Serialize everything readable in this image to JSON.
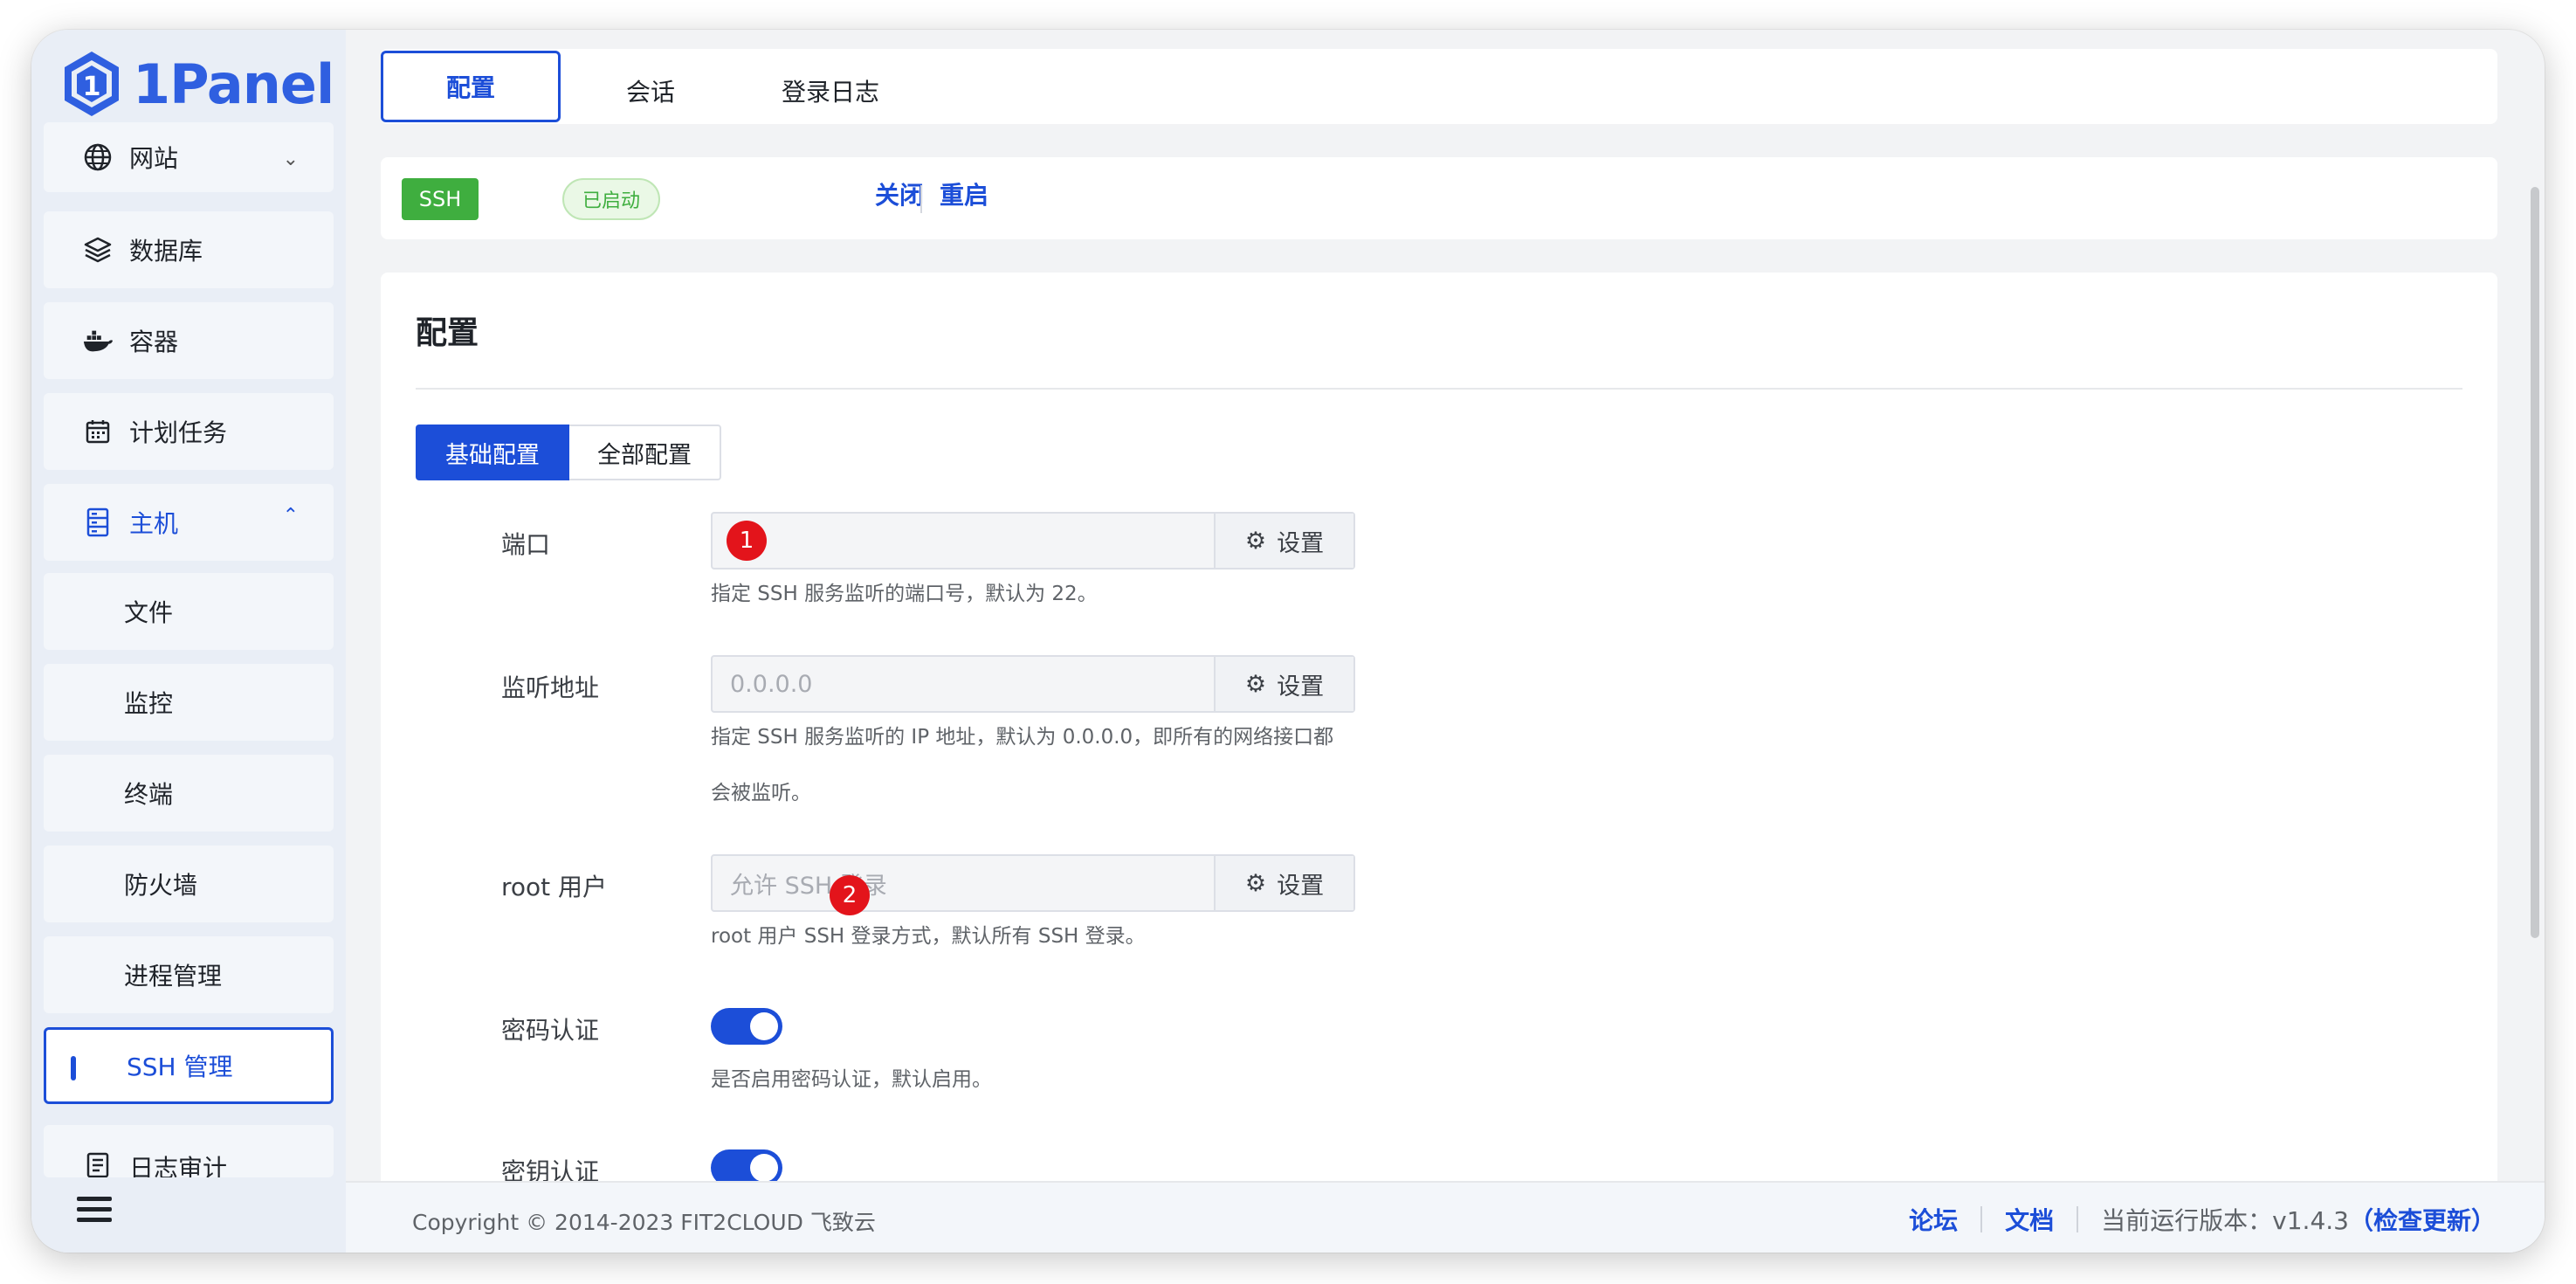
{
  "app": {
    "logo_text": "1Panel"
  },
  "sidebar": {
    "items": [
      {
        "label": "网站",
        "icon": "globe-icon"
      },
      {
        "label": "数据库",
        "icon": "layers-icon"
      },
      {
        "label": "容器",
        "icon": "docker-icon"
      },
      {
        "label": "计划任务",
        "icon": "calendar-icon"
      },
      {
        "label": "主机",
        "icon": "server-icon"
      },
      {
        "label": "文件"
      },
      {
        "label": "监控"
      },
      {
        "label": "终端"
      },
      {
        "label": "防火墙"
      },
      {
        "label": "进程管理"
      },
      {
        "label": "SSH 管理"
      },
      {
        "label": "日志审计",
        "icon": "log-icon"
      }
    ]
  },
  "tabs": [
    {
      "label": "配置"
    },
    {
      "label": "会话"
    },
    {
      "label": "登录日志"
    }
  ],
  "status": {
    "service": "SSH",
    "state": "已启动",
    "stop_label": "关闭",
    "restart_label": "重启",
    "badge_color": "#3fae3f"
  },
  "config": {
    "title": "配置",
    "segments": [
      {
        "label": "基础配置"
      },
      {
        "label": "全部配置"
      }
    ],
    "set_label": "设置",
    "fields": {
      "port": {
        "label": "端口",
        "value": "",
        "help": "指定 SSH 服务监听的端口号，默认为 22。"
      },
      "listen": {
        "label": "监听地址",
        "placeholder": "0.0.0.0",
        "help_line1": "指定 SSH 服务监听的 IP 地址，默认为 0.0.0.0，即所有的网络接口都",
        "help_line2": "会被监听。"
      },
      "root": {
        "label": "root 用户",
        "placeholder": "允许 SSH 登录",
        "help": "root 用户 SSH 登录方式，默认所有 SSH 登录。"
      },
      "password_auth": {
        "label": "密码认证",
        "enabled": true,
        "help": "是否启用密码认证，默认启用。"
      },
      "key_auth": {
        "label": "密钥认证",
        "enabled": true
      }
    },
    "markers": [
      "1",
      "2"
    ]
  },
  "footer": {
    "copyright": "Copyright © 2014-2023 FIT2CLOUD 飞致云",
    "forum": "论坛",
    "docs": "文档",
    "version_text": "当前运行版本：v1.4.3",
    "check_update": "（检查更新）"
  },
  "colors": {
    "accent": "#1c4ed8",
    "success": "#3fae3f",
    "marker": "#e3141b"
  }
}
